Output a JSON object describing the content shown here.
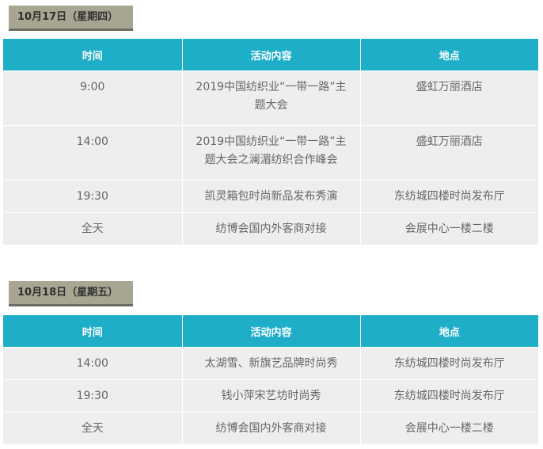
{
  "days": [
    {
      "tag": "10月17日（星期四）",
      "headers": {
        "time": "时间",
        "activity": "活动内容",
        "place": "地点"
      },
      "rows": [
        {
          "time": "9:00",
          "activity": "2019中国纺织业“一带一路”主题大会",
          "place": "盛虹万丽酒店"
        },
        {
          "time": "14:00",
          "activity": "2019中国纺织业“一带一路”主题大会之澜湄纺织合作峰会",
          "place": "盛虹万丽酒店"
        },
        {
          "time": "19:30",
          "activity": "凯灵箱包时尚新品发布秀演",
          "place": "东纺城四楼时尚发布厅"
        },
        {
          "time": "全天",
          "activity": "纺博会国内外客商对接",
          "place": "会展中心一楼二楼"
        }
      ]
    },
    {
      "tag": "10月18日（星期五）",
      "headers": {
        "time": "时间",
        "activity": "活动内容",
        "place": "地点"
      },
      "rows": [
        {
          "time": "14:00",
          "activity": "太湖雪、新旗艺品牌时尚秀",
          "place": "东纺城四楼时尚发布厅"
        },
        {
          "time": "19:30",
          "activity": "钱小萍宋艺坊时尚秀",
          "place": "东纺城四楼时尚发布厅"
        },
        {
          "time": "全天",
          "activity": "纺博会国内外客商对接",
          "place": "会展中心一楼二楼"
        }
      ]
    }
  ],
  "colors": {
    "header_bg": "#1eaec8",
    "row_bg": "#eeeeee",
    "tag_bg": "#a8a692",
    "tag_shadow": "#6f6d61"
  }
}
